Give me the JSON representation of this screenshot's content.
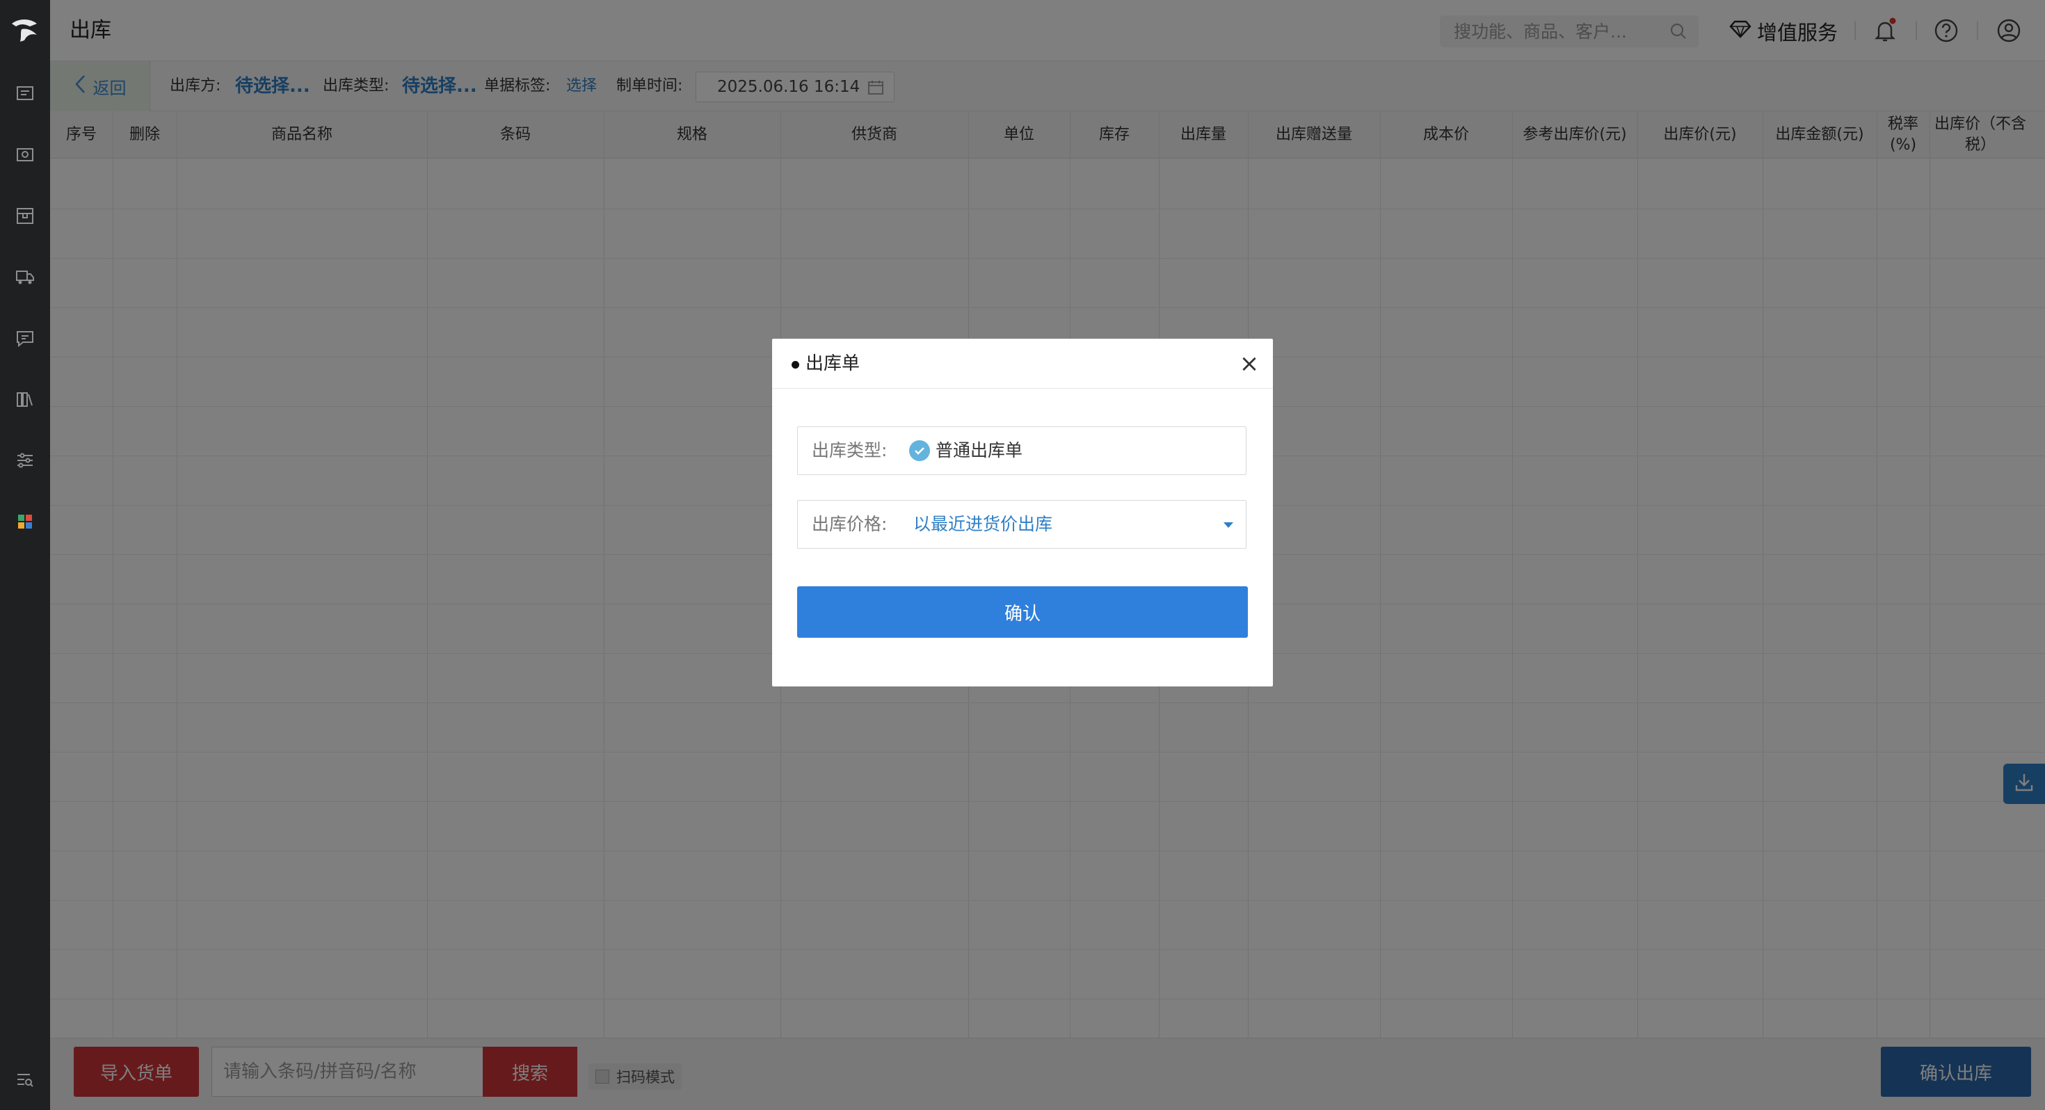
{
  "app": {
    "page_title": "出库"
  },
  "header": {
    "search": {
      "placeholder": "搜功能、商品、客户..."
    },
    "value_added_label": "增值服务"
  },
  "filters": {
    "back_label": "返回",
    "warehouse_out_party_label": "出库方:",
    "warehouse_out_party_value": "待选择...",
    "out_type_label": "出库类型:",
    "out_type_value": "待选择...",
    "doc_tag_label": "单据标签:",
    "doc_tag_action": "选择",
    "created_time_label": "制单时间:",
    "created_time_value": "2025.06.16 16:14"
  },
  "table": {
    "columns": [
      {
        "label": "序号"
      },
      {
        "label": "删除"
      },
      {
        "label": "商品名称"
      },
      {
        "label": "条码"
      },
      {
        "label": "规格"
      },
      {
        "label": "供货商"
      },
      {
        "label": "单位"
      },
      {
        "label": "库存"
      },
      {
        "label": "出库量"
      },
      {
        "label": "出库赠送量"
      },
      {
        "label": "成本价"
      },
      {
        "label": "参考出库价(元)"
      },
      {
        "label": "出库价(元)"
      },
      {
        "label": "出库金额(元)"
      },
      {
        "label": "税率\n(%)"
      },
      {
        "label": "出库价（不含税）"
      }
    ],
    "rows": []
  },
  "bottom": {
    "import_label": "导入货单",
    "code_placeholder": "请输入条码/拼音码/名称",
    "search_label": "搜索",
    "scan_mode_label": "扫码模式",
    "confirm_label": "确认出库"
  },
  "modal": {
    "title": "出库单",
    "close_symbol": "×",
    "type_label": "出库类型:",
    "type_value": "普通出库单",
    "price_label": "出库价格:",
    "price_value": "以最近进货价出库",
    "confirm_label": "确认"
  },
  "colors": {
    "accent_blue": "#2f7fdc",
    "link_blue": "#2f7fc5",
    "danger_red": "#cf3438",
    "sidebar_bg": "#1f2022",
    "notification_dot": "#e0352b"
  }
}
